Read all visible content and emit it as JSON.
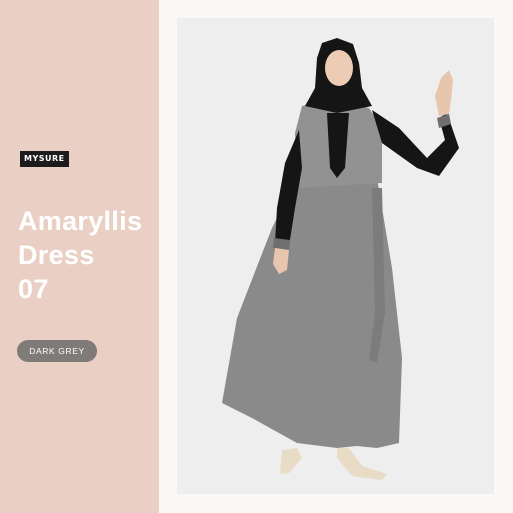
{
  "brand": {
    "logo_text": "MYSURE"
  },
  "product": {
    "name_line1": "Amaryllis",
    "name_line2": "Dress",
    "name_line3": "07",
    "color_label": "DARK GREY"
  },
  "colors": {
    "panel": "#e9cfc4",
    "page_bg": "#fbf8f6",
    "badge": "#7f7b79",
    "photo_bg": "#eeeeee",
    "dress": "#8b8a8a",
    "sleeves": "#151515"
  }
}
